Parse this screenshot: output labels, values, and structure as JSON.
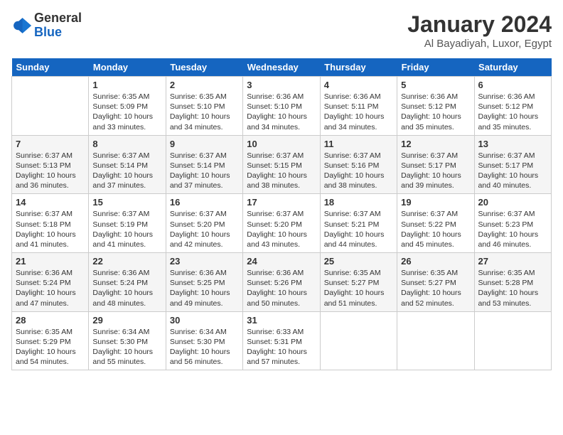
{
  "header": {
    "logo_general": "General",
    "logo_blue": "Blue",
    "month_year": "January 2024",
    "location": "Al Bayadiyah, Luxor, Egypt"
  },
  "days_of_week": [
    "Sunday",
    "Monday",
    "Tuesday",
    "Wednesday",
    "Thursday",
    "Friday",
    "Saturday"
  ],
  "weeks": [
    [
      {
        "day": "",
        "info": ""
      },
      {
        "day": "1",
        "info": "Sunrise: 6:35 AM\nSunset: 5:09 PM\nDaylight: 10 hours\nand 33 minutes."
      },
      {
        "day": "2",
        "info": "Sunrise: 6:35 AM\nSunset: 5:10 PM\nDaylight: 10 hours\nand 34 minutes."
      },
      {
        "day": "3",
        "info": "Sunrise: 6:36 AM\nSunset: 5:10 PM\nDaylight: 10 hours\nand 34 minutes."
      },
      {
        "day": "4",
        "info": "Sunrise: 6:36 AM\nSunset: 5:11 PM\nDaylight: 10 hours\nand 34 minutes."
      },
      {
        "day": "5",
        "info": "Sunrise: 6:36 AM\nSunset: 5:12 PM\nDaylight: 10 hours\nand 35 minutes."
      },
      {
        "day": "6",
        "info": "Sunrise: 6:36 AM\nSunset: 5:12 PM\nDaylight: 10 hours\nand 35 minutes."
      }
    ],
    [
      {
        "day": "7",
        "info": "Sunrise: 6:37 AM\nSunset: 5:13 PM\nDaylight: 10 hours\nand 36 minutes."
      },
      {
        "day": "8",
        "info": "Sunrise: 6:37 AM\nSunset: 5:14 PM\nDaylight: 10 hours\nand 37 minutes."
      },
      {
        "day": "9",
        "info": "Sunrise: 6:37 AM\nSunset: 5:14 PM\nDaylight: 10 hours\nand 37 minutes."
      },
      {
        "day": "10",
        "info": "Sunrise: 6:37 AM\nSunset: 5:15 PM\nDaylight: 10 hours\nand 38 minutes."
      },
      {
        "day": "11",
        "info": "Sunrise: 6:37 AM\nSunset: 5:16 PM\nDaylight: 10 hours\nand 38 minutes."
      },
      {
        "day": "12",
        "info": "Sunrise: 6:37 AM\nSunset: 5:17 PM\nDaylight: 10 hours\nand 39 minutes."
      },
      {
        "day": "13",
        "info": "Sunrise: 6:37 AM\nSunset: 5:17 PM\nDaylight: 10 hours\nand 40 minutes."
      }
    ],
    [
      {
        "day": "14",
        "info": "Sunrise: 6:37 AM\nSunset: 5:18 PM\nDaylight: 10 hours\nand 41 minutes."
      },
      {
        "day": "15",
        "info": "Sunrise: 6:37 AM\nSunset: 5:19 PM\nDaylight: 10 hours\nand 41 minutes."
      },
      {
        "day": "16",
        "info": "Sunrise: 6:37 AM\nSunset: 5:20 PM\nDaylight: 10 hours\nand 42 minutes."
      },
      {
        "day": "17",
        "info": "Sunrise: 6:37 AM\nSunset: 5:20 PM\nDaylight: 10 hours\nand 43 minutes."
      },
      {
        "day": "18",
        "info": "Sunrise: 6:37 AM\nSunset: 5:21 PM\nDaylight: 10 hours\nand 44 minutes."
      },
      {
        "day": "19",
        "info": "Sunrise: 6:37 AM\nSunset: 5:22 PM\nDaylight: 10 hours\nand 45 minutes."
      },
      {
        "day": "20",
        "info": "Sunrise: 6:37 AM\nSunset: 5:23 PM\nDaylight: 10 hours\nand 46 minutes."
      }
    ],
    [
      {
        "day": "21",
        "info": "Sunrise: 6:36 AM\nSunset: 5:24 PM\nDaylight: 10 hours\nand 47 minutes."
      },
      {
        "day": "22",
        "info": "Sunrise: 6:36 AM\nSunset: 5:24 PM\nDaylight: 10 hours\nand 48 minutes."
      },
      {
        "day": "23",
        "info": "Sunrise: 6:36 AM\nSunset: 5:25 PM\nDaylight: 10 hours\nand 49 minutes."
      },
      {
        "day": "24",
        "info": "Sunrise: 6:36 AM\nSunset: 5:26 PM\nDaylight: 10 hours\nand 50 minutes."
      },
      {
        "day": "25",
        "info": "Sunrise: 6:35 AM\nSunset: 5:27 PM\nDaylight: 10 hours\nand 51 minutes."
      },
      {
        "day": "26",
        "info": "Sunrise: 6:35 AM\nSunset: 5:27 PM\nDaylight: 10 hours\nand 52 minutes."
      },
      {
        "day": "27",
        "info": "Sunrise: 6:35 AM\nSunset: 5:28 PM\nDaylight: 10 hours\nand 53 minutes."
      }
    ],
    [
      {
        "day": "28",
        "info": "Sunrise: 6:35 AM\nSunset: 5:29 PM\nDaylight: 10 hours\nand 54 minutes."
      },
      {
        "day": "29",
        "info": "Sunrise: 6:34 AM\nSunset: 5:30 PM\nDaylight: 10 hours\nand 55 minutes."
      },
      {
        "day": "30",
        "info": "Sunrise: 6:34 AM\nSunset: 5:30 PM\nDaylight: 10 hours\nand 56 minutes."
      },
      {
        "day": "31",
        "info": "Sunrise: 6:33 AM\nSunset: 5:31 PM\nDaylight: 10 hours\nand 57 minutes."
      },
      {
        "day": "",
        "info": ""
      },
      {
        "day": "",
        "info": ""
      },
      {
        "day": "",
        "info": ""
      }
    ]
  ]
}
